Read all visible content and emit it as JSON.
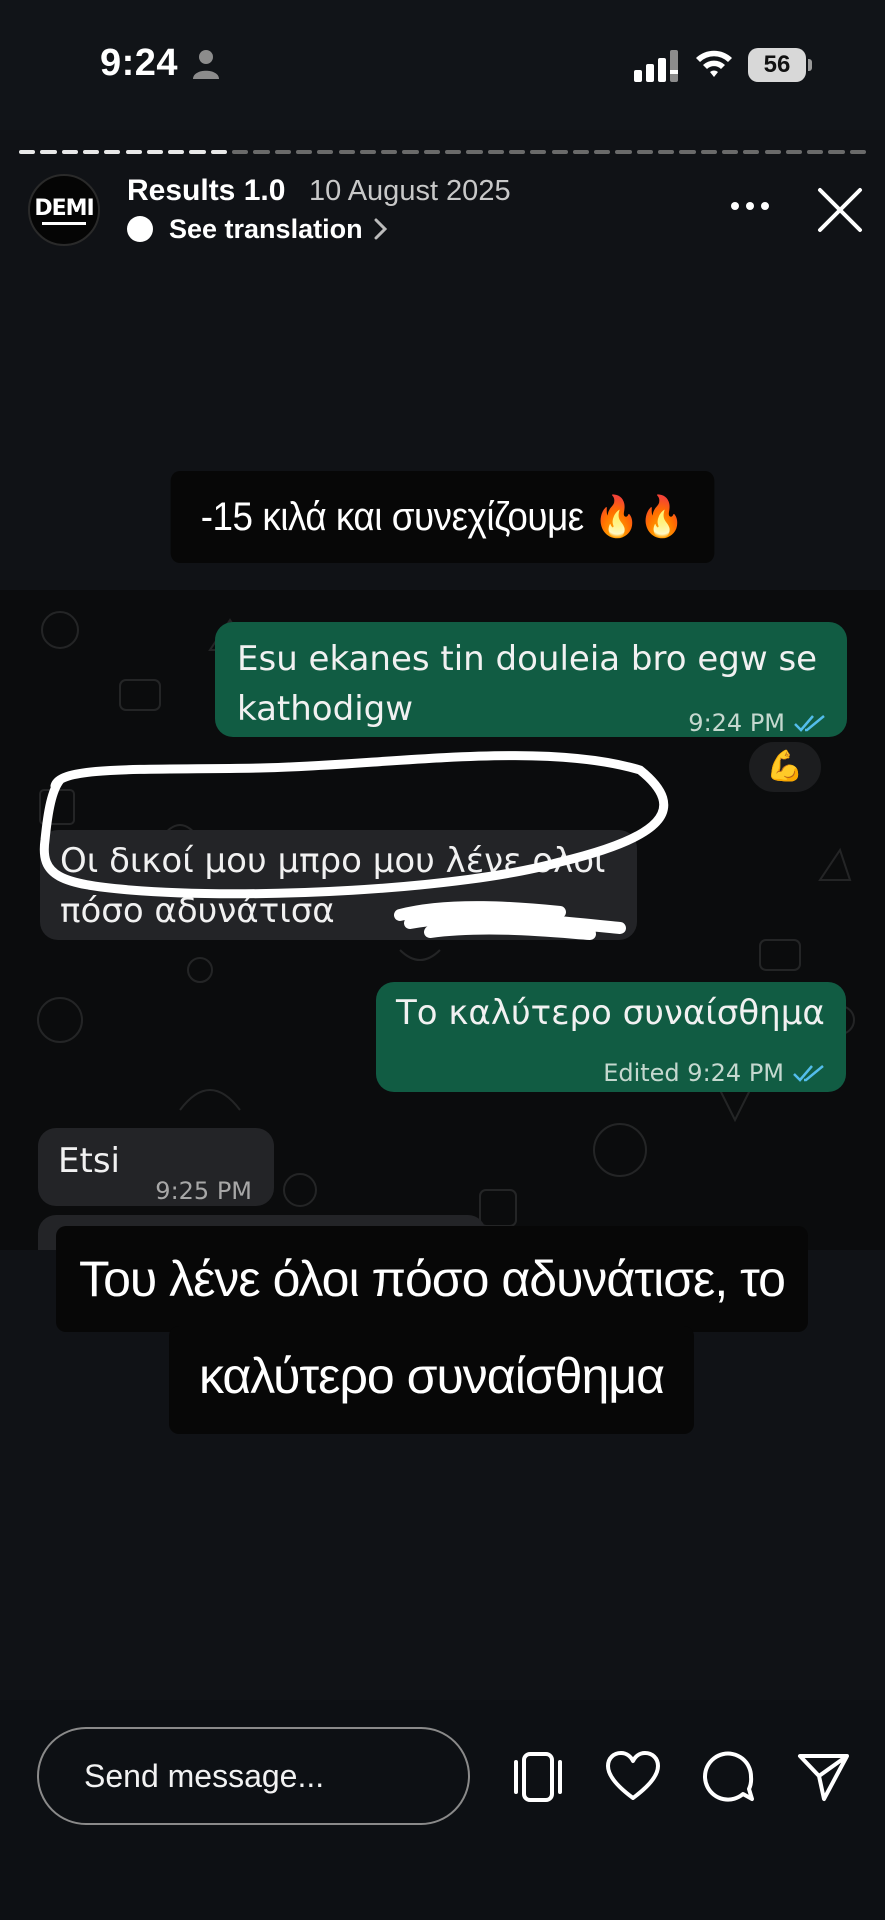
{
  "status_bar": {
    "time": "9:24",
    "battery": "56"
  },
  "story_header": {
    "avatar_text": "DEMI",
    "title": "Results 1.0",
    "date": "10 August 2025",
    "translate_label": "See translation"
  },
  "story_content": {
    "caption_top": "-15 κιλά και συνεχίζουμε 🔥🔥",
    "caption_bottom_line1": "Του λένε όλοι πόσο αδυνάτισε, το",
    "caption_bottom_line2": "καλύτερο συναίσθημα"
  },
  "chat": {
    "messages": [
      {
        "direction": "out",
        "text": "Esu ekanes tin douleia bro egw se\nkathodigw",
        "time": "9:24 PM"
      },
      {
        "direction": "in",
        "text": "Οι δικοί μου μπρο μου λένε ολοι\nπόσο αδυνάτισα",
        "time": ""
      },
      {
        "direction": "out",
        "text": "Το καλύτερο συναίσθημα",
        "time": "Edited 9:24 PM"
      },
      {
        "direction": "in",
        "text": "Etsi",
        "time": "9:25 PM"
      }
    ],
    "reaction": "💪"
  },
  "bottom_bar": {
    "input_placeholder": "Send message..."
  },
  "colors": {
    "outgoing_bubble": "#115c43",
    "incoming_bubble": "#232427",
    "read_ticks": "#53bdeb",
    "background": "#101216"
  },
  "icons": [
    "person-icon",
    "signal-icon",
    "wifi-icon",
    "battery-icon",
    "more-icon",
    "close-icon",
    "chevron-right-icon",
    "device-icon",
    "heart-icon",
    "comment-icon",
    "send-icon"
  ]
}
